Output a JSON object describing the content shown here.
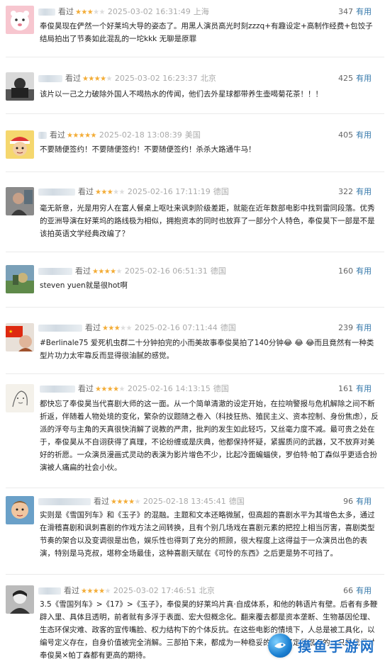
{
  "useful_label": "有用",
  "watched_label": "看过",
  "reviews": [
    {
      "avatar": "pink-cartoon-avatar",
      "stars": 3,
      "time": "2025-03-02 16:31:49",
      "location": "上海",
      "count": "347",
      "content": "奉俊昊现在俨然一个好莱坞大导的姿态了。用黑人演员高光时刻zzzq+有趣设定+高制作经费+包饺子结局拍出了节奏如此混乱的一坨kkk 无聊是原罪"
    },
    {
      "avatar": "dark-photo-avatar",
      "stars": 4,
      "time": "2025-03-02 16:23:37",
      "location": "北京",
      "count": "425",
      "content": "该片以一己之力破除外国人不喝热水的传闻，他们去外星球都带养生壶喝菊花茶！！！"
    },
    {
      "avatar": "cartoon-boy-avatar",
      "stars": 5,
      "time": "2025-02-18 13:08:39",
      "location": "美国",
      "count": "405",
      "content": "不要随便签约！不要随便签约！不要随便签约！杀杀大路通牛马！"
    },
    {
      "avatar": "portrait-photo-avatar",
      "stars": 3,
      "time": "2025-02-16 17:11:19",
      "location": "德国",
      "count": "322",
      "content": "毫无新意，光是用穷人在富人餐桌上呕吐来讽刺阶级差距，就能在近年数部电影中找到雷同段落。优秀的亚洲导演在好莱坞的路线极为相似，拥抱资本的同时也放弃了一部分个人特色，奉俊昊下一部是不是该拍英语文学经典改编了？"
    },
    {
      "avatar": "landscape-photo-avatar",
      "stars": 4,
      "time": "2025-02-16 06:51:31",
      "location": "德国",
      "count": "160",
      "content": "steven yuen就是很hot啊"
    },
    {
      "avatar": "red-flag-avatar",
      "stars": 3,
      "time": "2025-02-16 07:11:44",
      "location": "德国",
      "count": "239",
      "content": "#Berlinale75 爱死机虫群二十分钟拍完的小而美故事奉俊昊拍了140分钟😂 😂 😂而且竟然有一种类型片功力太牢靠反而显得很油腻的感觉。"
    },
    {
      "avatar": "sketch-avatar",
      "stars": 4,
      "time": "2025-02-16 14:13:15",
      "location": "德国",
      "count": "161",
      "content": "都快忘了奉俊昊当代喜剧大师的这一面。从一个简单清澈的设定开始，在拉响警报与危机解除之间不断折返，伴随着人物处境的变化，繁杂的议题随之卷入（科技狂热、殖民主义、资本控制、身份焦虑），反派的浮夸与主角的天真很快消解了说教的严肃，批判的发生如此轻巧，又丝毫力度不减。最可贵之处在于，奉俊昊从不自诩获得了真理，不论纷缠或是庆典，他都保持怀疑，紧握质问的武器，又不放弃对美好的祈愿。一众演员漫画式灵动的表演为影片增色不少，比起冷面蝙蝠侠，罗伯特·帕丁森似乎更适合扮演被人痛扁的社会小伙。"
    },
    {
      "avatar": "illustrated-face-avatar",
      "stars": 4,
      "time": "2025-02-18 13:45:41",
      "location": "德国",
      "count": "96",
      "content": "实则是《雪国列车》和《玉子》的混融。主题和文本还略微腻，但高超的喜剧水平为其增色太多，通过在滑稽喜剧和讽刺喜剧的作戏方法之间转换，且有个别几场戏在喜剧元素的把控上相当厉害，喜剧类型节奏的架合以及变调很是出色，娱乐性也得到了充分的照顾，很大程度上这得益于一众演员出色的表演，特别是马克叔，堪称全场最佳，这种喜剧天赋在《可怜的东西》之后更是势不可挡了。"
    },
    {
      "avatar": "bw-portrait-avatar",
      "stars": 4,
      "time": "2025-03-02 17:46:51",
      "location": "北京",
      "count": "66",
      "content": "3.5《雪国列车》>《17》>《玉子》，奉俊昊的好莱坞片真·自成体系，和他的韩语片有壁。后者有多鞭辟入里、具体且透明，前者就有多浮于表面、宏大但概念化。翻来覆去都是资本垄断、生物基因伦理、生态环保灾难、政客的宣传嘴脸、权力结构下的个体反抗。在这些电影的情境下，人总是被工具化，以编号定义存在，自身价值被完全消解。三部拍下来，都成为一种稳妥的套路了定是很可的，只是我们对奉俊昊×帕丁森都有更高的期待。"
    }
  ],
  "watermark": {
    "text": "摸鱼手游网"
  }
}
